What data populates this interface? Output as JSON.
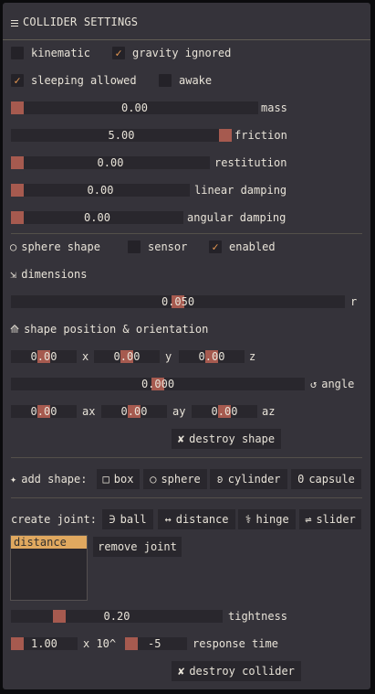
{
  "title": "COLLIDER SETTINGS",
  "flags": {
    "kinematic": {
      "label": "kinematic",
      "checked": false
    },
    "gravity_ignored": {
      "label": "gravity ignored",
      "checked": true
    },
    "sleeping_allowed": {
      "label": "sleeping allowed",
      "checked": true
    },
    "awake": {
      "label": "awake",
      "checked": false
    }
  },
  "sliders": {
    "mass": {
      "value": "0.00",
      "label": "mass"
    },
    "friction": {
      "value": "5.00",
      "label": "friction"
    },
    "restitution": {
      "value": "0.00",
      "label": "restitution"
    },
    "linear_damping": {
      "value": "0.00",
      "label": "linear damping"
    },
    "angular_damping": {
      "value": "0.00",
      "label": "angular damping"
    }
  },
  "shape_row": {
    "sphere": {
      "icon": "○",
      "label": "sphere shape"
    },
    "sensor": {
      "label": "sensor",
      "checked": false
    },
    "enabled": {
      "label": "enabled",
      "checked": true
    }
  },
  "dimensions": {
    "header": "dimensions",
    "icon": "⇲",
    "r": {
      "value": "0.050",
      "label": "r"
    }
  },
  "position_header": {
    "icon": "⟰",
    "label": "shape position & orientation"
  },
  "position": {
    "x": {
      "value": "0.00",
      "label": "x"
    },
    "y": {
      "value": "0.00",
      "label": "y"
    },
    "z": {
      "value": "0.00",
      "label": "z"
    }
  },
  "angle": {
    "value": "0.000",
    "icon": "↺",
    "label": "angle"
  },
  "axis": {
    "ax": {
      "value": "0.00",
      "label": "ax"
    },
    "ay": {
      "value": "0.00",
      "label": "ay"
    },
    "az": {
      "value": "0.00",
      "label": "az"
    }
  },
  "destroy_shape": {
    "icon": "✘",
    "label": "destroy shape"
  },
  "add_shape": {
    "label": "add shape:",
    "icon": "✦",
    "buttons": [
      {
        "icon": "□",
        "label": "box"
      },
      {
        "icon": "○",
        "label": "sphere"
      },
      {
        "icon": "ʚ",
        "label": "cylinder"
      },
      {
        "icon": "0",
        "label": "capsule"
      }
    ]
  },
  "create_joint": {
    "label": "create joint:",
    "buttons": [
      {
        "icon": "∋",
        "label": "ball"
      },
      {
        "icon": "↔",
        "label": "distance"
      },
      {
        "icon": "⚕",
        "label": "hinge"
      },
      {
        "icon": "⇌",
        "label": "slider"
      }
    ]
  },
  "joint_list": {
    "items": [
      "distance"
    ],
    "selected": "distance"
  },
  "remove_joint": {
    "label": "remove joint"
  },
  "tightness": {
    "value": "0.20",
    "label": "tightness"
  },
  "response_time": {
    "mantissa": "1.00",
    "x10": "x 10^",
    "exponent": "-5",
    "label": "response time"
  },
  "destroy_collider": {
    "icon": "✘",
    "label": "destroy collider"
  },
  "colors": {
    "panel": "#35333a",
    "field": "#29272d",
    "accent": "#e99a53",
    "knob": "#a65a4f",
    "selected": "#e0a85f"
  }
}
